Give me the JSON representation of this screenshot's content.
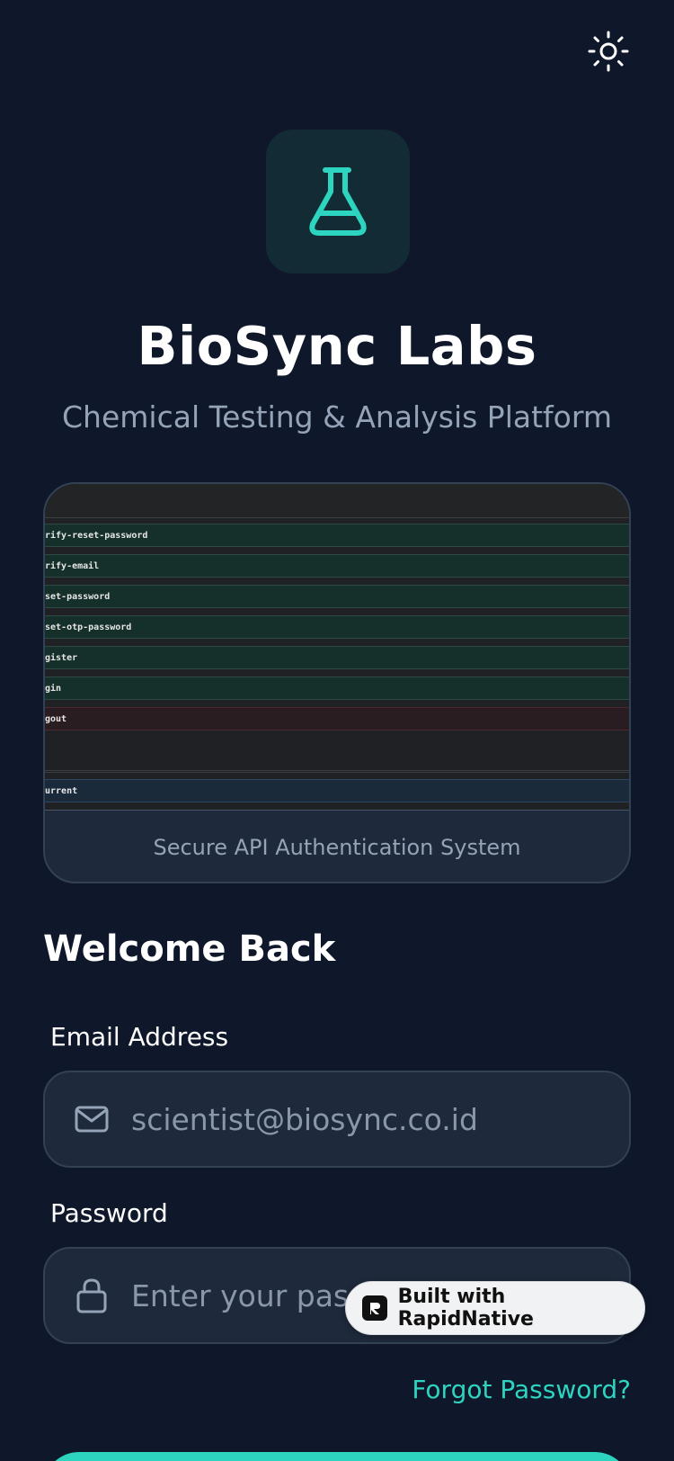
{
  "app": {
    "title": "BioSync Labs",
    "subtitle": "Chemical Testing & Analysis Platform"
  },
  "theme_toggle": {
    "icon": "sun-icon"
  },
  "logo": {
    "icon": "flask-icon",
    "color": "#2dd4bf"
  },
  "preview": {
    "rows": [
      {
        "label": "rify-reset-password",
        "kind": "green"
      },
      {
        "label": "rify-email",
        "kind": "green"
      },
      {
        "label": "set-password",
        "kind": "green"
      },
      {
        "label": "set-otp-password",
        "kind": "green"
      },
      {
        "label": "gister",
        "kind": "green"
      },
      {
        "label": "gin",
        "kind": "green"
      },
      {
        "label": "gout",
        "kind": "red"
      },
      {
        "label": "urrent",
        "kind": "blue"
      }
    ],
    "caption": "Secure API Authentication System"
  },
  "form": {
    "heading": "Welcome Back",
    "email_label": "Email Address",
    "email_placeholder": "scientist@biosync.co.id",
    "password_label": "Password",
    "password_placeholder": "Enter your password",
    "forgot_label": "Forgot Password?"
  },
  "badge": {
    "text": "Built with RapidNative"
  },
  "colors": {
    "background": "#0f172a",
    "accent": "#2dd4bf",
    "field_bg": "#1e293b"
  }
}
